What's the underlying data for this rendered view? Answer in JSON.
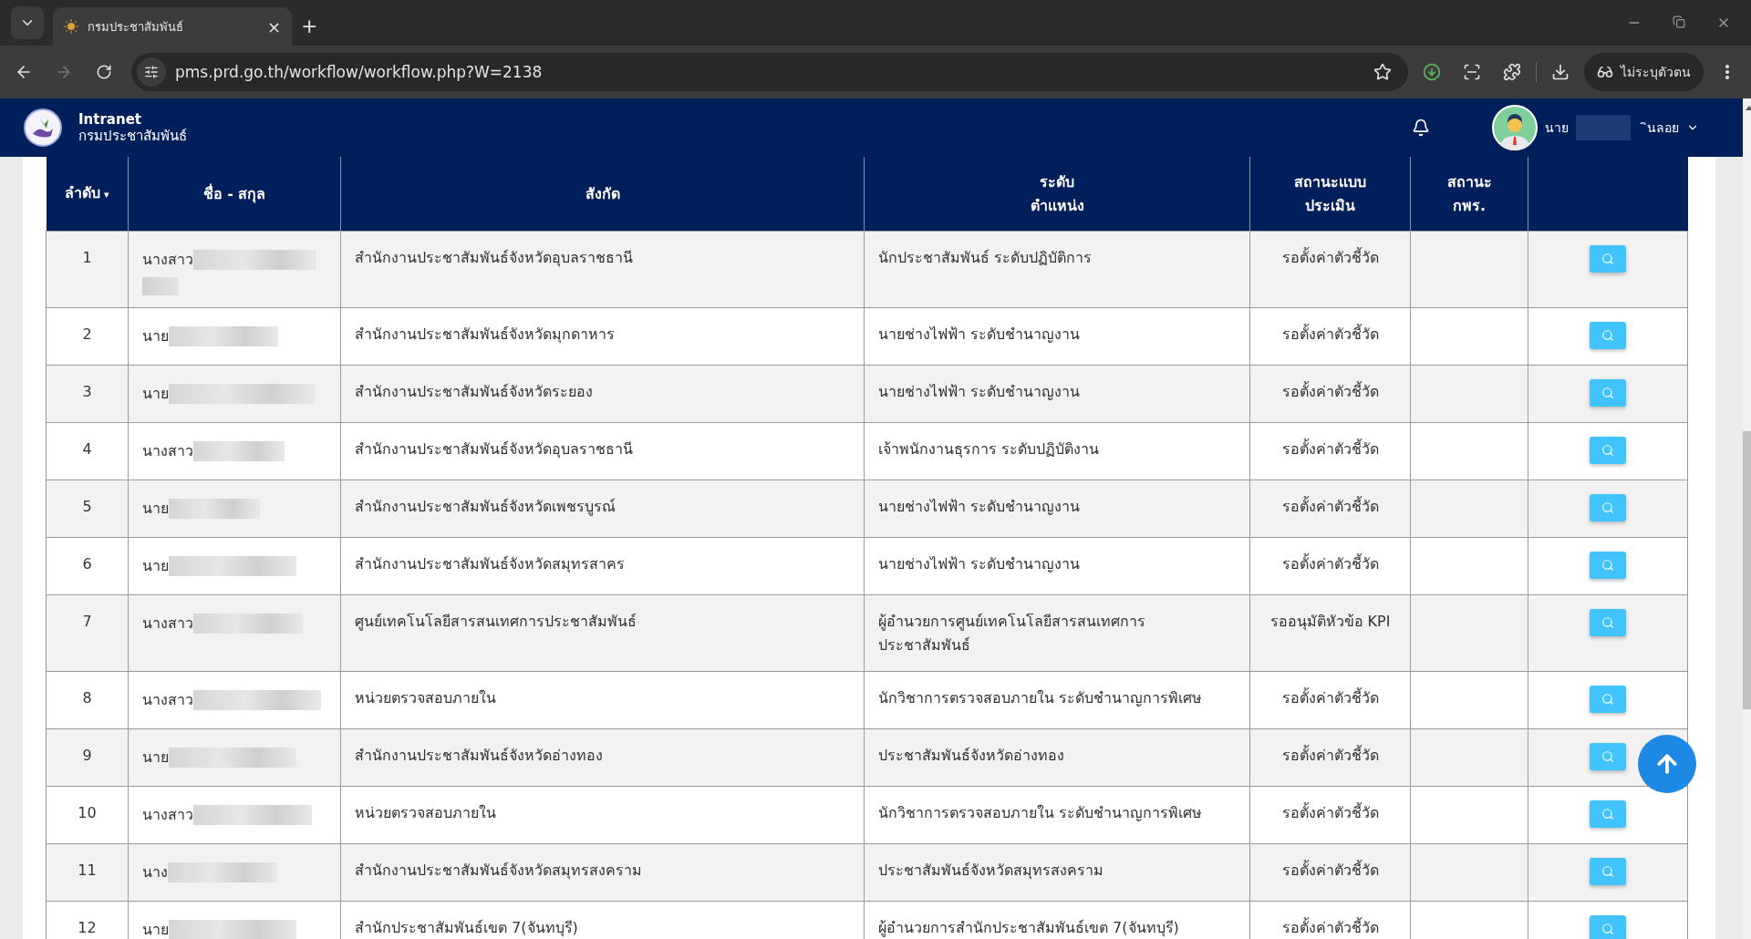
{
  "browser": {
    "tab": {
      "title": "กรมประชาสัมพันธ์",
      "close": "×"
    },
    "new_tab": "+",
    "url": "pms.prd.go.th/workflow/workflow.php?W=2138",
    "profile": "ไม่ระบุตัวตน"
  },
  "header": {
    "brand": "Intranet",
    "org": "กรมประชาสัมพันธ์",
    "user_prefix": "นาย",
    "user_suffix": "ินลอย"
  },
  "table": {
    "columns": [
      {
        "label": "ลำดับ",
        "sort_indicator": "▾"
      },
      {
        "label": "ชื่อ - สกุล"
      },
      {
        "label": "สังกัด"
      },
      {
        "label": "ระดับตำแหน่ง"
      },
      {
        "label": "สถานะแบบประเมิน"
      },
      {
        "label": "สถานะ กพร."
      }
    ],
    "rows": [
      {
        "no": "1",
        "title": "นางสาว",
        "unit": "สำนักงานประชาสัมพันธ์จังหวัดอุบลราชธานี",
        "position": "นักประชาสัมพันธ์ ระดับปฏิบัติการ",
        "status": "รอตั้งค่าตัวชี้วัด"
      },
      {
        "no": "2",
        "title": "นาย",
        "unit": "สำนักงานประชาสัมพันธ์จังหวัดมุกดาหาร",
        "position": "นายช่างไฟฟ้า ระดับชำนาญงาน",
        "status": "รอตั้งค่าตัวชี้วัด"
      },
      {
        "no": "3",
        "title": "นาย",
        "unit": "สำนักงานประชาสัมพันธ์จังหวัดระยอง",
        "position": "นายช่างไฟฟ้า ระดับชำนาญงาน",
        "status": "รอตั้งค่าตัวชี้วัด"
      },
      {
        "no": "4",
        "title": "นางสาว",
        "unit": "สำนักงานประชาสัมพันธ์จังหวัดอุบลราชธานี",
        "position": "เจ้าพนักงานธุรการ ระดับปฏิบัติงาน",
        "status": "รอตั้งค่าตัวชี้วัด"
      },
      {
        "no": "5",
        "title": "นาย",
        "unit": "สำนักงานประชาสัมพันธ์จังหวัดเพชรบูรณ์",
        "position": "นายช่างไฟฟ้า ระดับชำนาญงาน",
        "status": "รอตั้งค่าตัวชี้วัด"
      },
      {
        "no": "6",
        "title": "นาย",
        "unit": "สำนักงานประชาสัมพันธ์จังหวัดสมุทรสาคร",
        "position": "นายช่างไฟฟ้า ระดับชำนาญงาน",
        "status": "รอตั้งค่าตัวชี้วัด"
      },
      {
        "no": "7",
        "title": "นางสาว",
        "unit": "ศูนย์เทคโนโลยีสารสนเทศการประชาสัมพันธ์",
        "position": "ผู้อำนวยการศูนย์เทคโนโลยีสารสนเทศการประชาสัมพันธ์",
        "status": "รออนุมัติหัวข้อ KPI"
      },
      {
        "no": "8",
        "title": "นางสาว",
        "unit": "หน่วยตรวจสอบภายใน",
        "position": "นักวิชาการตรวจสอบภายใน ระดับชำนาญการพิเศษ",
        "status": "รอตั้งค่าตัวชี้วัด"
      },
      {
        "no": "9",
        "title": "นาย",
        "unit": "สำนักงานประชาสัมพันธ์จังหวัดอ่างทอง",
        "position": "ประชาสัมพันธ์จังหวัดอ่างทอง",
        "status": "รอตั้งค่าตัวชี้วัด"
      },
      {
        "no": "10",
        "title": "นางสาว",
        "unit": "หน่วยตรวจสอบภายใน",
        "position": "นักวิชาการตรวจสอบภายใน ระดับชำนาญการพิเศษ",
        "status": "รอตั้งค่าตัวชี้วัด"
      },
      {
        "no": "11",
        "title": "นาง",
        "unit": "สำนักงานประชาสัมพันธ์จังหวัดสมุทรสงคราม",
        "position": "ประชาสัมพันธ์จังหวัดสมุทรสงคราม",
        "status": "รอตั้งค่าตัวชี้วัด"
      },
      {
        "no": "12",
        "title": "นาย",
        "unit": "สำนักประชาสัมพันธ์เขต 7(จันทบุรี)",
        "position": "ผู้อำนวยการสำนักประชาสัมพันธ์เขต 7(จันทบุรี)",
        "status": "รอตั้งค่าตัวชี้วัด"
      }
    ]
  }
}
